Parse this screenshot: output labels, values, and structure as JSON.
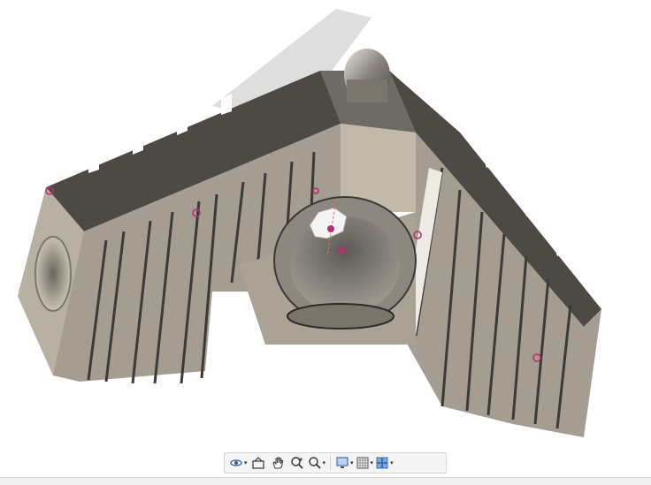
{
  "viewport": {
    "model_body_color": "#a59d92",
    "model_dark_color": "#4d4a46",
    "marker_color": "#b0316f",
    "shadow_color": "#d2d2d2"
  },
  "nav_toolbar": {
    "items": [
      {
        "icon": "orbit-icon",
        "has_dropdown": true
      },
      {
        "icon": "look-at-icon",
        "has_dropdown": false
      },
      {
        "icon": "pan-hand-icon",
        "has_dropdown": false
      },
      {
        "icon": "zoom-icon",
        "has_dropdown": false
      },
      {
        "icon": "fit-zoom-icon",
        "has_dropdown": true
      },
      {
        "icon": "display-settings-icon",
        "has_dropdown": true
      },
      {
        "icon": "grid-icon",
        "has_dropdown": true
      },
      {
        "icon": "viewports-icon",
        "has_dropdown": true
      }
    ],
    "caret_glyph": "▾"
  }
}
